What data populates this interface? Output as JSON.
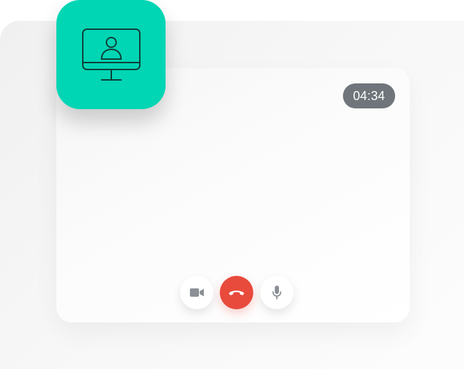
{
  "call": {
    "timer": "04:34"
  },
  "icons": {
    "app": "monitor-user-icon",
    "camera": "video-camera-icon",
    "hangup": "phone-hangup-icon",
    "mic": "microphone-icon"
  },
  "colors": {
    "accent": "#00d5b4",
    "hangup": "#e84a3c",
    "timer_bg": "#6f757b",
    "control_icon": "#8b9096"
  }
}
